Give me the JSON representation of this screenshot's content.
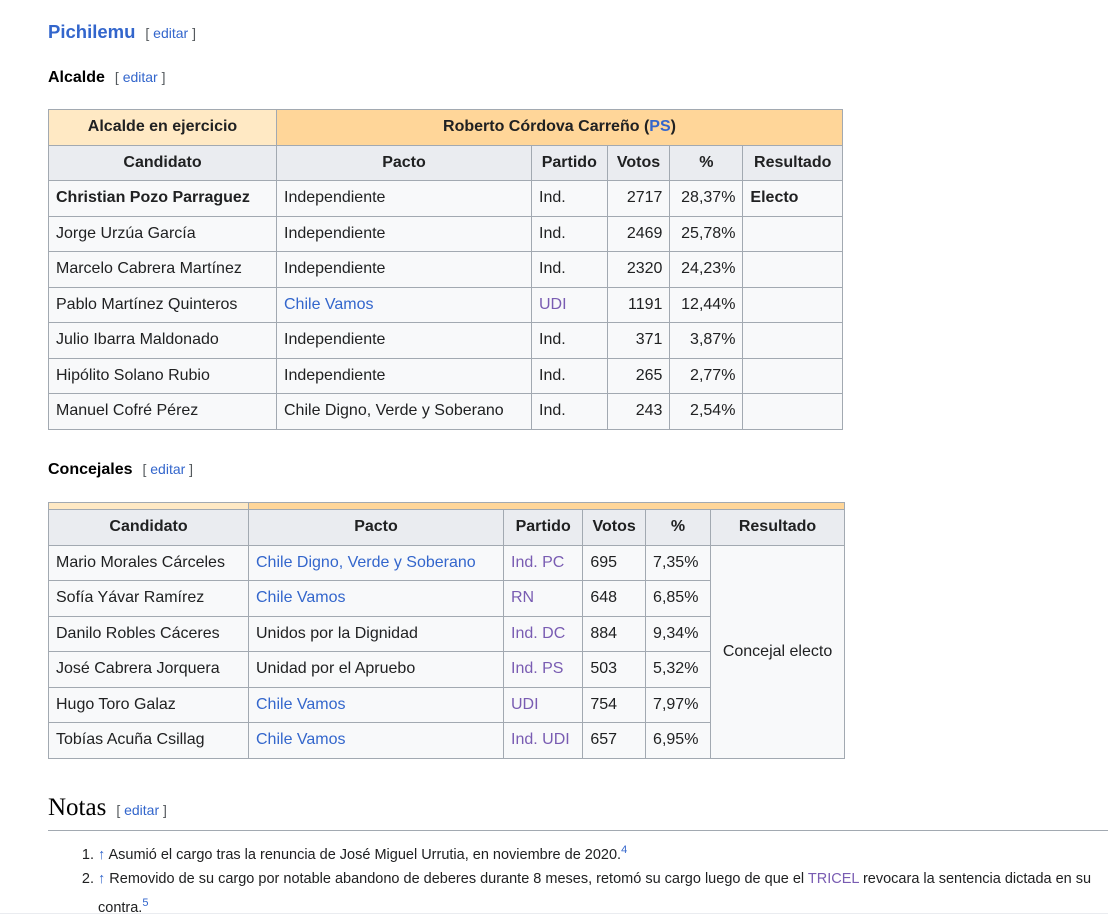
{
  "section": {
    "title": "Pichilemu",
    "edit_label": "editar"
  },
  "alcalde": {
    "heading": "Alcalde",
    "edit_label": "editar",
    "incumbent_label": "Alcalde en ejercicio",
    "incumbent_name": "Roberto Córdova Carreño (",
    "incumbent_party": "PS",
    "incumbent_close": ")",
    "headers": [
      "Candidato",
      "Pacto",
      "Partido",
      "Votos",
      "%",
      "Resultado"
    ],
    "rows": [
      {
        "candidato": "Christian Pozo Parraguez",
        "pacto": "Independiente",
        "partido": "Ind.",
        "votos": "2717",
        "pct": "28,37%",
        "resultado": "Electo"
      },
      {
        "candidato": "Jorge Urzúa García",
        "pacto": "Independiente",
        "partido": "Ind.",
        "votos": "2469",
        "pct": "25,78%",
        "resultado": ""
      },
      {
        "candidato": "Marcelo Cabrera Martínez",
        "pacto": "Independiente",
        "partido": "Ind.",
        "votos": "2320",
        "pct": "24,23%",
        "resultado": ""
      },
      {
        "candidato": "Pablo Martínez Quinteros",
        "pacto": "Chile Vamos",
        "partido": "UDI",
        "votos": "1191",
        "pct": "12,44%",
        "resultado": ""
      },
      {
        "candidato": "Julio Ibarra Maldonado",
        "pacto": "Independiente",
        "partido": "Ind.",
        "votos": "371",
        "pct": "3,87%",
        "resultado": ""
      },
      {
        "candidato": "Hipólito Solano Rubio",
        "pacto": "Independiente",
        "partido": "Ind.",
        "votos": "265",
        "pct": "2,77%",
        "resultado": ""
      },
      {
        "candidato": "Manuel Cofré Pérez",
        "pacto": "Chile Digno, Verde y Soberano",
        "partido": "Ind.",
        "votos": "243",
        "pct": "2,54%",
        "resultado": ""
      }
    ]
  },
  "concejales": {
    "heading": "Concejales",
    "edit_label": "editar",
    "headers": [
      "Candidato",
      "Pacto",
      "Partido",
      "Votos",
      "%",
      "Resultado"
    ],
    "resultado": "Concejal electo",
    "rows": [
      {
        "candidato": "Mario Morales Cárceles",
        "pacto": "Chile Digno, Verde y Soberano",
        "partido": "Ind. PC",
        "votos": "695",
        "pct": "7,35%"
      },
      {
        "candidato": "Sofía Yávar Ramírez",
        "pacto": "Chile Vamos",
        "partido": "RN",
        "votos": "648",
        "pct": "6,85%"
      },
      {
        "candidato": "Danilo Robles Cáceres",
        "pacto": "Unidos por la Dignidad",
        "partido": "Ind. DC",
        "votos": "884",
        "pct": "9,34%"
      },
      {
        "candidato": "José Cabrera Jorquera",
        "pacto": "Unidad por el Apruebo",
        "partido": "Ind. PS",
        "votos": "503",
        "pct": "5,32%"
      },
      {
        "candidato": "Hugo Toro Galaz",
        "pacto": "Chile Vamos",
        "partido": "UDI",
        "votos": "754",
        "pct": "7,97%"
      },
      {
        "candidato": "Tobías Acuña Csillag",
        "pacto": "Chile Vamos",
        "partido": "Ind. UDI",
        "votos": "657",
        "pct": "6,95%"
      }
    ]
  },
  "notas": {
    "heading": "Notas",
    "edit_label": "editar",
    "arrow": "↑",
    "note1": {
      "text": "Asumió el cargo tras la renuncia de José Miguel Urrutia, en noviembre de 2020.",
      "ref": "4"
    },
    "note2": {
      "text_before": "Removido de su cargo por notable abandono de deberes durante 8 meses, retomó su cargo luego de que el ",
      "link": "TRICEL",
      "text_after": " revocara la sentencia dictada en su contra.",
      "ref": "5"
    }
  }
}
